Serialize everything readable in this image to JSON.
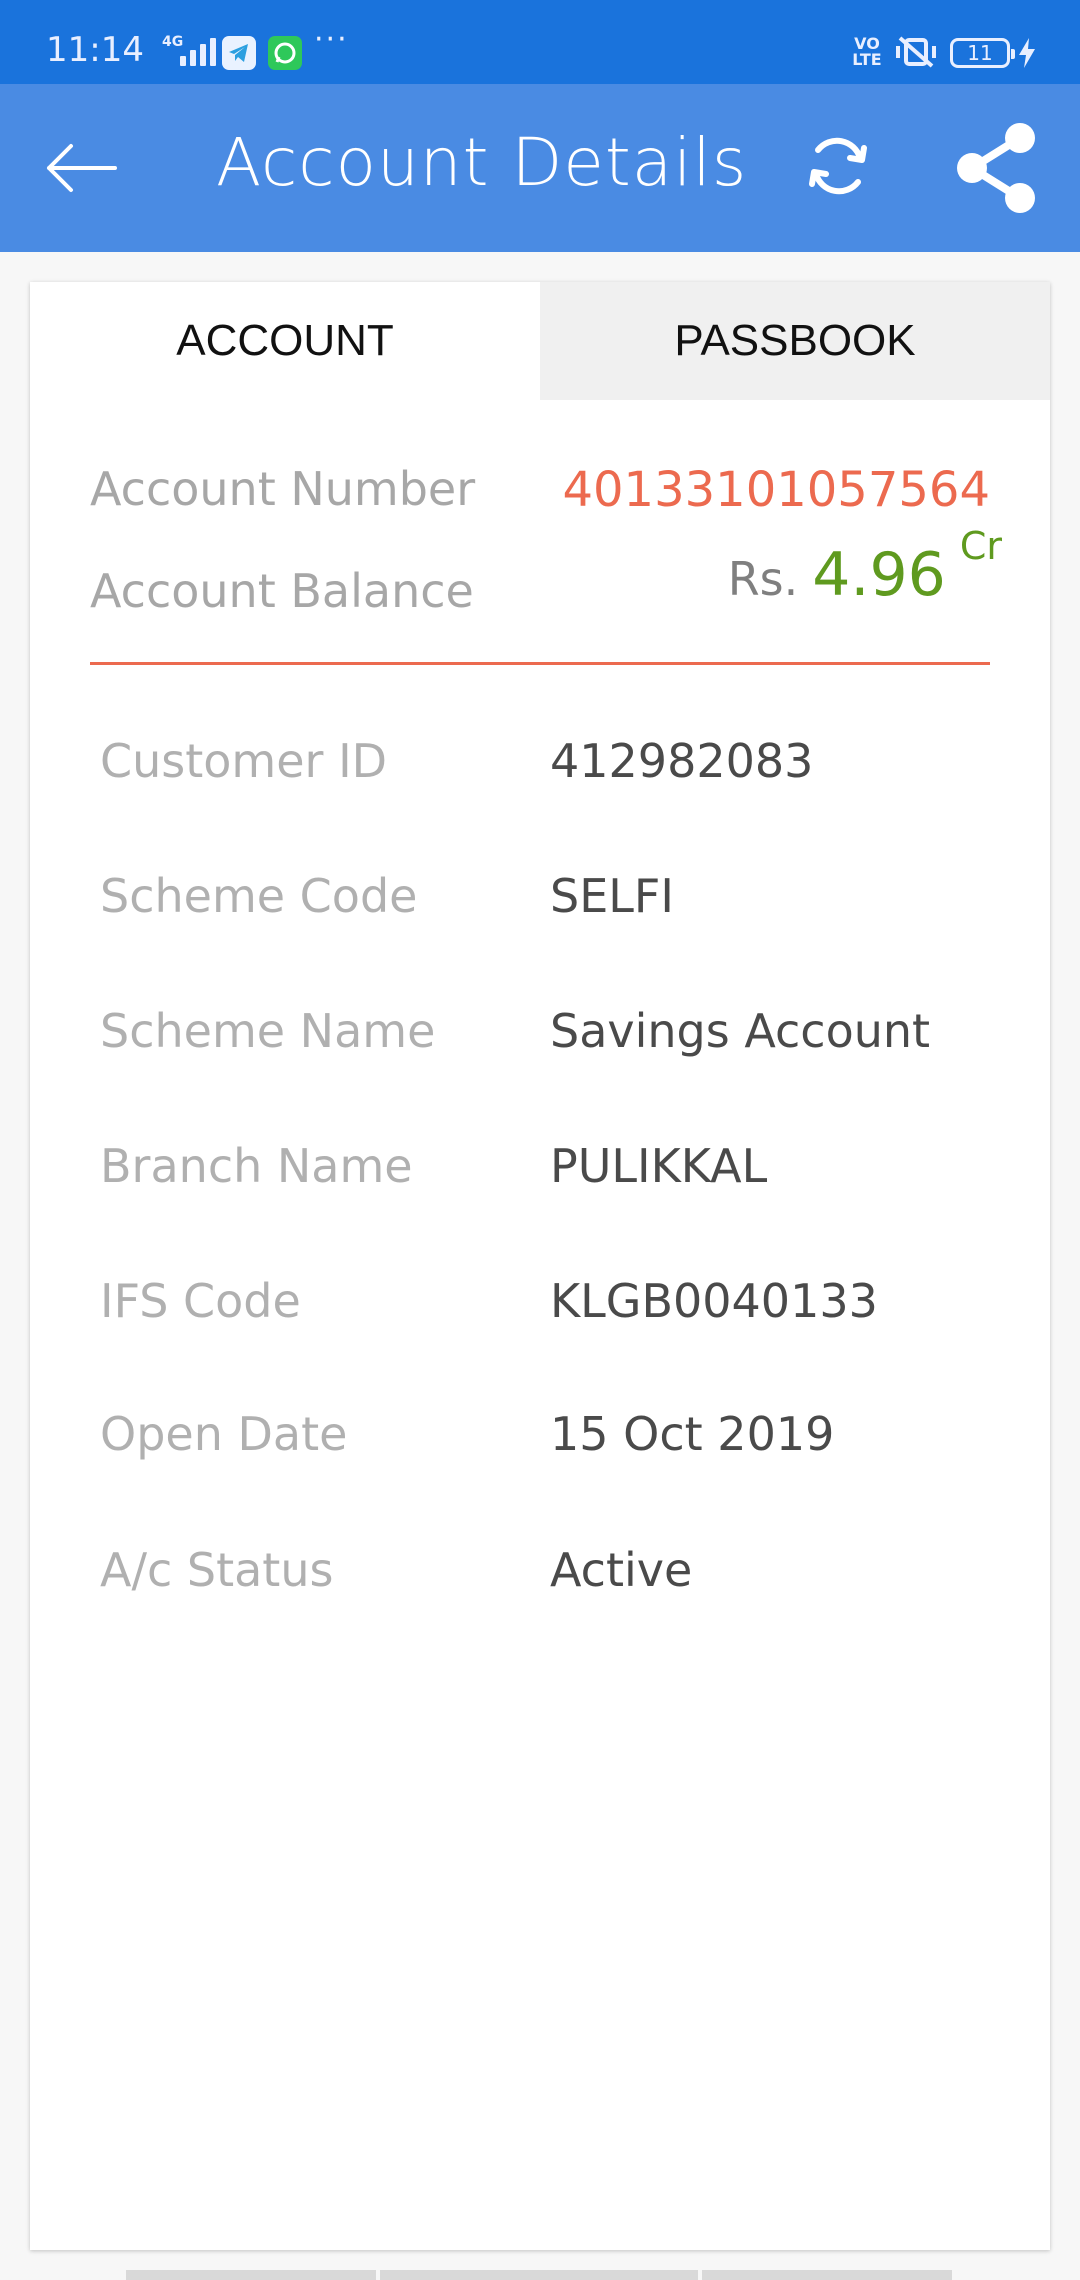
{
  "status_bar": {
    "time": "11:14",
    "network": "4G",
    "volte": "VO LTE",
    "battery": "11"
  },
  "app_bar": {
    "title": "Account Details",
    "back_icon": "arrow-left-icon",
    "refresh_icon": "refresh-icon",
    "share_icon": "share-icon",
    "color": "#4a8be3"
  },
  "tabs": [
    {
      "label": "ACCOUNT",
      "selected": true
    },
    {
      "label": "PASSBOOK",
      "selected": false
    }
  ],
  "summary": {
    "account_number_label": "Account Number",
    "account_number": "40133101057564",
    "balance_label": "Account Balance",
    "balance_currency": "Rs.",
    "balance_amount": "4.96",
    "balance_type": "Cr",
    "accent_color": "#ec6a4f",
    "balance_color": "#5f9a1f"
  },
  "details": [
    {
      "label": "Customer ID",
      "value": "412982083"
    },
    {
      "label": "Scheme Code",
      "value": "SELFI"
    },
    {
      "label": "Scheme Name",
      "value": "Savings Account"
    },
    {
      "label": "Branch Name",
      "value": "PULIKKAL"
    },
    {
      "label": "IFS Code",
      "value": "KLGB0040133"
    },
    {
      "label": "Open Date",
      "value": "15 Oct 2019"
    },
    {
      "label": "A/c Status",
      "value": "Active"
    }
  ]
}
